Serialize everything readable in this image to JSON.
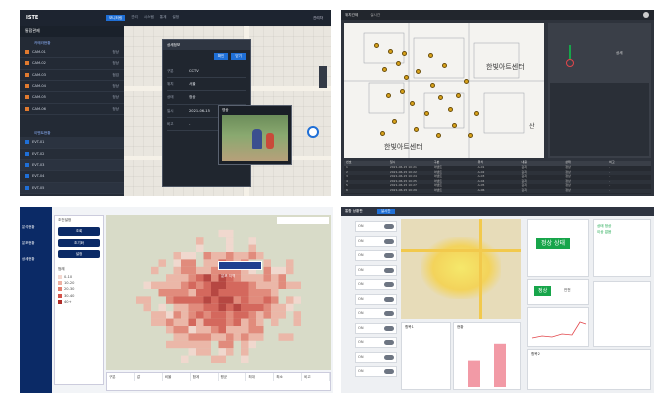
{
  "p1": {
    "logo": "ISTE",
    "tabs": [
      {
        "label": "모니터링"
      },
      {
        "label": "관리"
      },
      {
        "label": "시스템"
      },
      {
        "label": "통계"
      },
      {
        "label": "설정"
      }
    ],
    "user": "관리자",
    "sidebar_title": "통합관제",
    "group1": "카메라현황",
    "group2": "이벤트현황",
    "list1": [
      {
        "name": "CAM-01",
        "val": "정상"
      },
      {
        "name": "CAM-02",
        "val": "정상"
      },
      {
        "name": "CAM-03",
        "val": "점검"
      },
      {
        "name": "CAM-04",
        "val": "정상"
      },
      {
        "name": "CAM-05",
        "val": "정상"
      },
      {
        "name": "CAM-06",
        "val": "정상"
      }
    ],
    "list2": [
      {
        "name": "EVT-01"
      },
      {
        "name": "EVT-02"
      },
      {
        "name": "EVT-03"
      },
      {
        "name": "EVT-04"
      },
      {
        "name": "EVT-05"
      },
      {
        "name": "EVT-06"
      },
      {
        "name": "EVT-07"
      }
    ],
    "popup": {
      "title": "상세정보",
      "btn1": "확인",
      "btn2": "닫기",
      "fields": [
        {
          "k": "구분",
          "v": "CCTV"
        },
        {
          "k": "위치",
          "v": "서울"
        },
        {
          "k": "상태",
          "v": "정상"
        },
        {
          "k": "일시",
          "v": "2021-06-15"
        },
        {
          "k": "비고",
          "v": "-"
        }
      ],
      "video_label": "영상"
    }
  },
  "p2": {
    "title": "위치관제",
    "subtitle": "실시간",
    "map_labels": [
      "한빛아트센터",
      "산",
      "한빛아트센터"
    ],
    "right_label": "상세",
    "table_headers": [
      "번호",
      "일시",
      "구분",
      "위치",
      "내용",
      "상태",
      "비고"
    ],
    "table_rows": [
      [
        "1",
        "2021-06-15 10:21",
        "이벤트",
        "A-01",
        "감지",
        "정상",
        "-"
      ],
      [
        "2",
        "2021-06-15 10:22",
        "이벤트",
        "A-02",
        "감지",
        "정상",
        "-"
      ],
      [
        "3",
        "2021-06-15 10:24",
        "이벤트",
        "A-03",
        "감지",
        "정상",
        "-"
      ],
      [
        "4",
        "2021-06-15 10:25",
        "이벤트",
        "A-04",
        "감지",
        "정상",
        "-"
      ],
      [
        "5",
        "2021-06-15 10:27",
        "이벤트",
        "A-05",
        "감지",
        "정상",
        "-"
      ],
      [
        "6",
        "2021-06-15 10:29",
        "이벤트",
        "A-06",
        "감지",
        "정상",
        "-"
      ]
    ]
  },
  "p3": {
    "sidebar_items": [
      "분석현황",
      "분포현황",
      "상세현황"
    ],
    "filter_title": "조건설정",
    "buttons": [
      "조회",
      "초기화",
      "설정"
    ],
    "legend_title": "범례",
    "legend_items": [
      "0-10",
      "10-20",
      "20-30",
      "30-40",
      "40+"
    ],
    "tooltip": "분포 지역",
    "footer_cols": [
      "구분",
      "값",
      "비율",
      "합계",
      "평균",
      "최대",
      "최소",
      "비고"
    ]
  },
  "p4": {
    "title": "통합 상황판",
    "tab": "실시간",
    "status_big": "정상 상태",
    "status_small": "정상",
    "status_detail": "안전",
    "right_notes": [
      "상태 정상",
      "이상 없음"
    ],
    "controls": [
      "ON",
      "ON",
      "ON",
      "ON",
      "ON",
      "ON",
      "ON",
      "ON",
      "ON",
      "ON",
      "ON"
    ],
    "chart_title": "현황",
    "bottom_labels": [
      "항목1",
      "항목2"
    ]
  },
  "colors": {
    "dark_header": "#1d2430",
    "accent_blue": "#1f6fd6",
    "navy": "#0b2a66",
    "heat_red": "#c8413c",
    "status_green": "#17a54a"
  },
  "chart_data": {
    "type": "bar",
    "categories": [
      "1",
      "2"
    ],
    "values": [
      55,
      90
    ],
    "title": "",
    "xlabel": "",
    "ylabel": ""
  }
}
